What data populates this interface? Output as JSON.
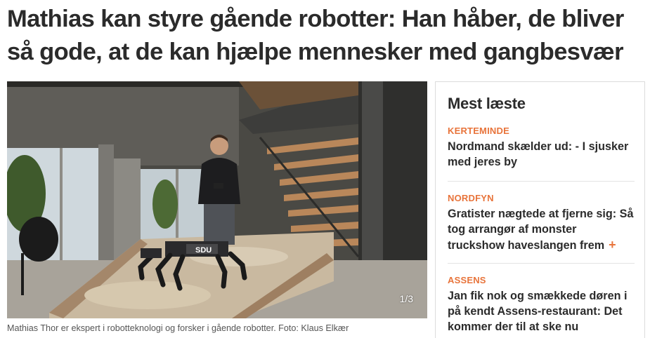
{
  "article": {
    "headline": "Mathias kan styre gående robotter: Han håber, de bliver så gode, at de kan hjælpe mennesker med gangbesvær",
    "image_caption": "Mathias Thor er ekspert i robotteknologi og forsker i gående robotter. Foto: Klaus Elkær",
    "gallery_counter": "1/3",
    "robot_brand_text": "SDU"
  },
  "sidebar": {
    "title": "Mest læste",
    "items": [
      {
        "category": "KERTEMINDE",
        "title": "Nordmand skælder ud: - I sjusker med jeres by",
        "plus": false
      },
      {
        "category": "NORDFYN",
        "title": "Gratister nægtede at fjerne sig: Så tog arrangør af monster truckshow haveslangen frem",
        "plus": true,
        "plus_symbol": "+"
      },
      {
        "category": "ASSENS",
        "title": "Jan fik nok og smækkede døren i på kendt Assens-restaurant: Det kommer der til at ske nu",
        "plus": false
      }
    ]
  },
  "colors": {
    "accent": "#e8743b",
    "text": "#2b2b2b",
    "caption": "#555555"
  }
}
